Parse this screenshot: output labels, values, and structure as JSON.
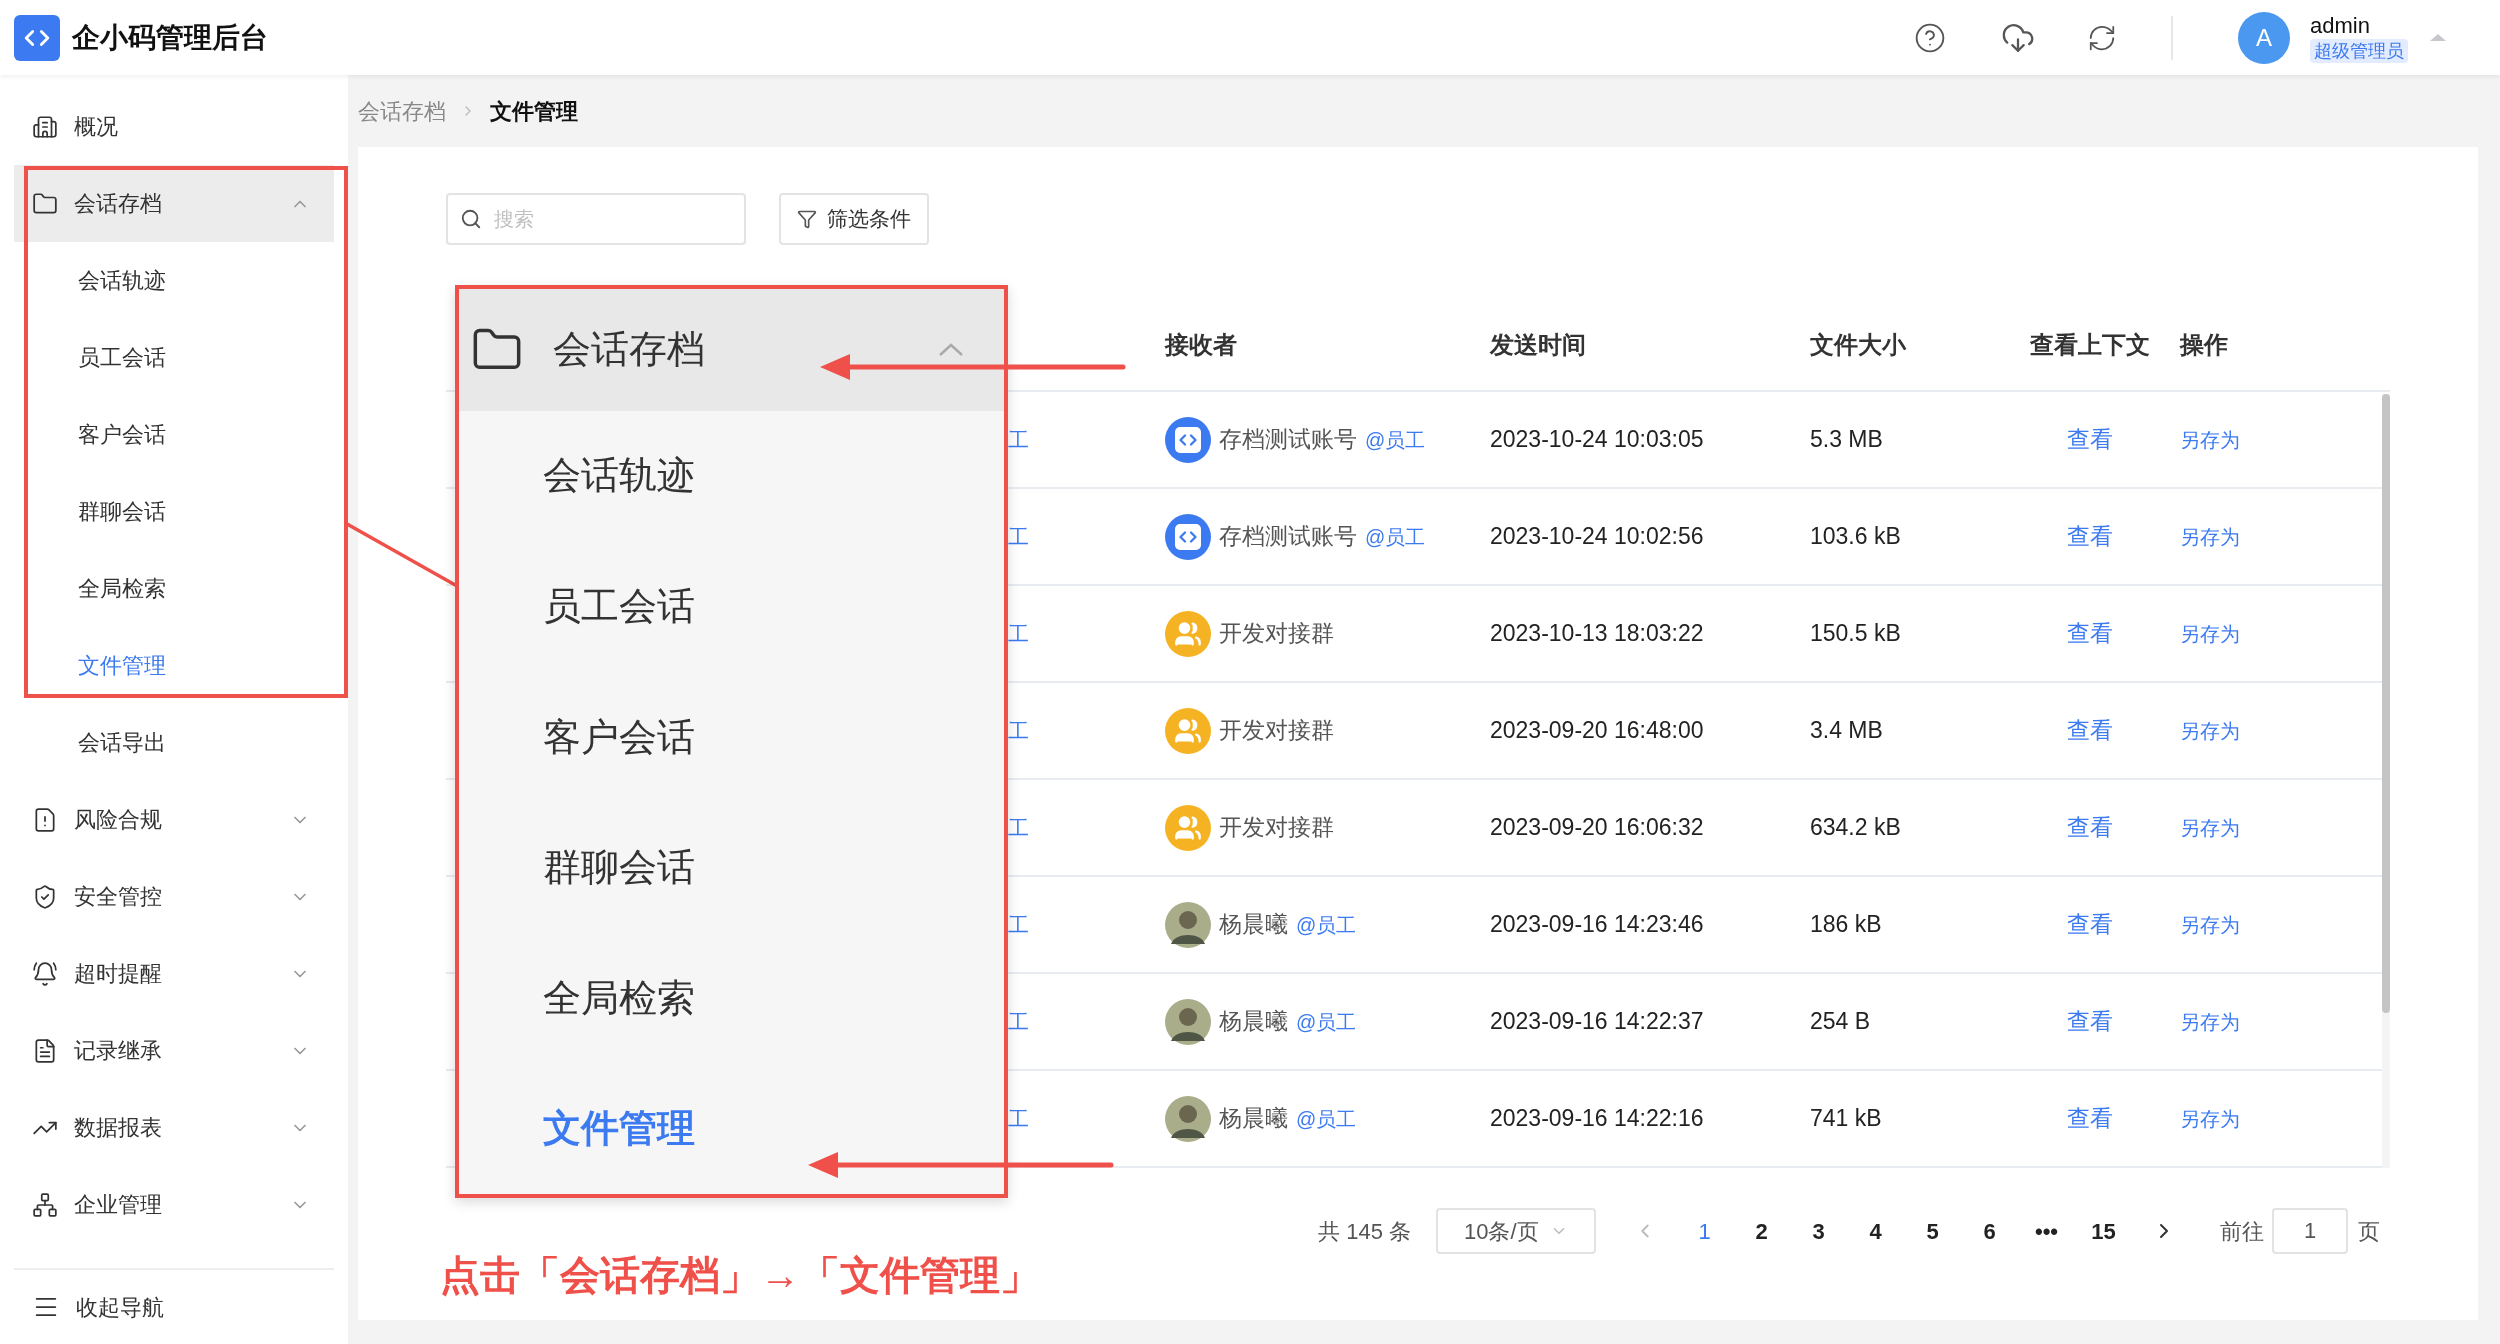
{
  "app": {
    "title": "企小码管理后台"
  },
  "header": {
    "user": {
      "avatar_letter": "A",
      "name": "admin",
      "role": "超级管理员"
    }
  },
  "sidebar": {
    "items": [
      {
        "label": "概况",
        "kind": "building",
        "selected": false
      },
      {
        "label": "会话存档",
        "kind": "folder",
        "selected": true,
        "expanded": true,
        "children": [
          {
            "label": "会话轨迹",
            "selected": false
          },
          {
            "label": "员工会话",
            "selected": false
          },
          {
            "label": "客户会话",
            "selected": false
          },
          {
            "label": "群聊会话",
            "selected": false
          },
          {
            "label": "全局检索",
            "selected": false
          },
          {
            "label": "文件管理",
            "selected": true
          },
          {
            "label": "会话导出",
            "selected": false
          }
        ]
      },
      {
        "label": "风险合规",
        "kind": "alert",
        "selected": false,
        "expanded": false
      },
      {
        "label": "安全管控",
        "kind": "shield",
        "selected": false,
        "expanded": false
      },
      {
        "label": "超时提醒",
        "kind": "bell",
        "selected": false,
        "expanded": false
      },
      {
        "label": "记录继承",
        "kind": "record",
        "selected": false,
        "expanded": false
      },
      {
        "label": "数据报表",
        "kind": "chart",
        "selected": false,
        "expanded": false
      },
      {
        "label": "企业管理",
        "kind": "org",
        "selected": false,
        "expanded": false
      }
    ],
    "collapse": "收起导航"
  },
  "breadcrumb": [
    "会话存档",
    "文件管理"
  ],
  "toolbar": {
    "search": {
      "placeholder": "搜索"
    },
    "filter_button": "筛选条件"
  },
  "table": {
    "columns": [
      "接收者",
      "发送时间",
      "文件大小",
      "查看上下文",
      "操作"
    ],
    "rows": [
      {
        "column_1": "工",
        "receiver": {
          "kind": "app",
          "name": "存档测试账号",
          "tag": "@员工"
        },
        "time": "2023-10-24 10:03:05",
        "size": "5.3 MB",
        "view": "查看",
        "action": "另存为"
      },
      {
        "column_1": "工",
        "receiver": {
          "kind": "app",
          "name": "存档测试账号",
          "tag": "@员工"
        },
        "time": "2023-10-24 10:02:56",
        "size": "103.6 kB",
        "view": "查看",
        "action": "另存为"
      },
      {
        "column_1": "工",
        "receiver": {
          "kind": "group",
          "name": "开发对接群"
        },
        "time": "2023-10-13 18:03:22",
        "size": "150.5 kB",
        "view": "查看",
        "action": "另存为"
      },
      {
        "column_1": "工",
        "receiver": {
          "kind": "group",
          "name": "开发对接群"
        },
        "time": "2023-09-20 16:48:00",
        "size": "3.4 MB",
        "view": "查看",
        "action": "另存为"
      },
      {
        "column_1": "工",
        "receiver": {
          "kind": "group",
          "name": "开发对接群"
        },
        "time": "2023-09-20 16:06:32",
        "size": "634.2 kB",
        "view": "查看",
        "action": "另存为"
      },
      {
        "column_1": "工",
        "receiver": {
          "kind": "person",
          "name": "杨晨曦",
          "tag": "@员工"
        },
        "time": "2023-09-16 14:23:46",
        "size": "186 kB",
        "view": "查看",
        "action": "另存为"
      },
      {
        "column_1": "工",
        "receiver": {
          "kind": "person",
          "name": "杨晨曦",
          "tag": "@员工"
        },
        "time": "2023-09-16 14:22:37",
        "size": "254 B",
        "view": "查看",
        "action": "另存为"
      },
      {
        "column_1": "工",
        "receiver": {
          "kind": "person",
          "name": "杨晨曦",
          "tag": "@员工"
        },
        "time": "2023-09-16 14:22:16",
        "size": "741 kB",
        "view": "查看",
        "action": "另存为"
      }
    ]
  },
  "pagination": {
    "total": "共 145 条",
    "page_size": "10条/页",
    "pages": [
      {
        "label": "1",
        "selected": true
      },
      {
        "label": "2",
        "selected": false
      },
      {
        "label": "3",
        "selected": false
      },
      {
        "label": "4",
        "selected": false
      },
      {
        "label": "5",
        "selected": false
      },
      {
        "label": "6",
        "selected": false
      },
      {
        "label": "•••",
        "selected": false
      },
      {
        "label": "15",
        "selected": false
      }
    ],
    "goto_label": "前往",
    "goto_value": "1",
    "goto_suffix": "页"
  },
  "annotation": {
    "zoom": {
      "heading": "会话存档",
      "expanded": true,
      "items": [
        {
          "label": "会话轨迹",
          "selected": false
        },
        {
          "label": "员工会话",
          "selected": false
        },
        {
          "label": "客户会话",
          "selected": false
        },
        {
          "label": "群聊会话",
          "selected": false
        },
        {
          "label": "全局检索",
          "selected": false
        },
        {
          "label": "文件管理",
          "selected": true
        }
      ]
    },
    "caption": "点击「会话存档」→「文件管理」"
  }
}
